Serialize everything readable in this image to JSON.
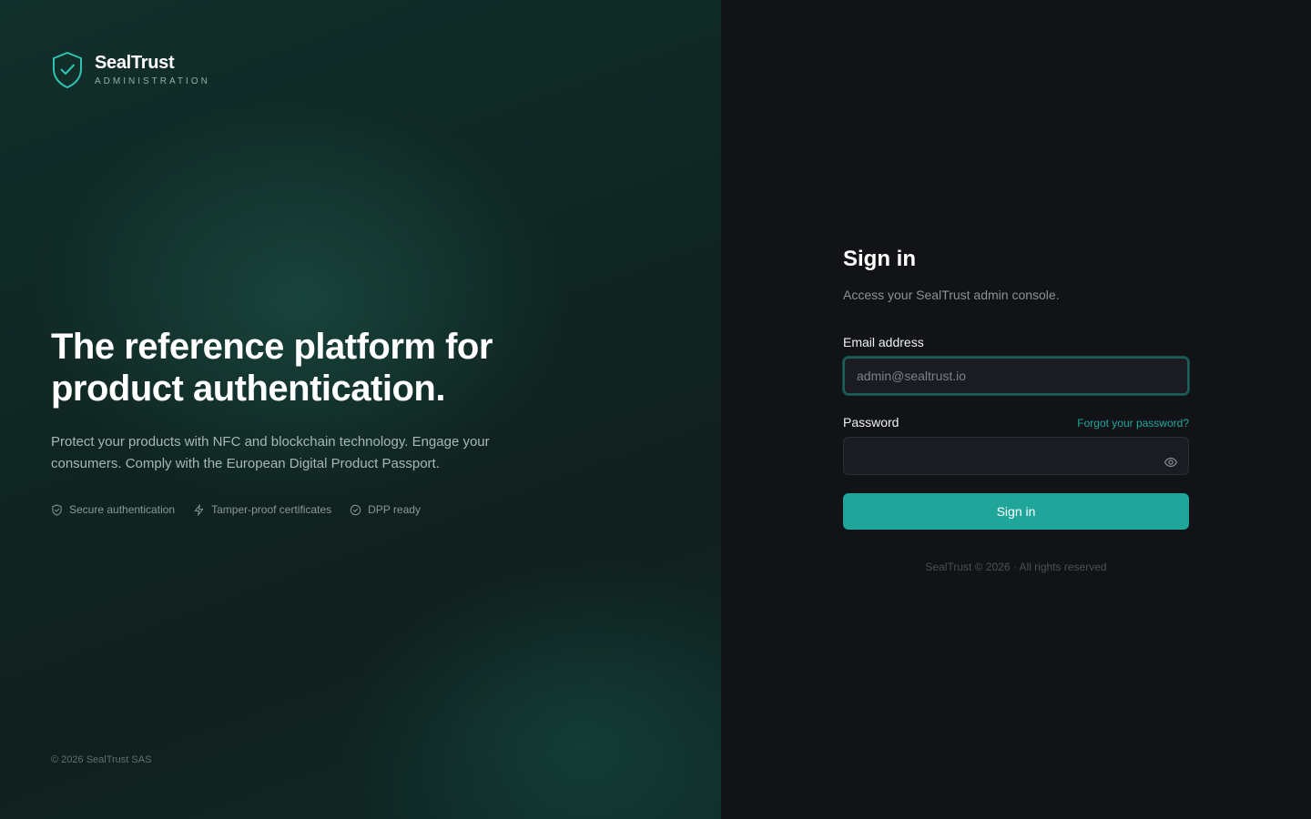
{
  "brand": {
    "name": "SealTrust",
    "subtitle": "ADMINISTRATION",
    "logo_icon": "shield-check-icon",
    "accent_color": "#1fa59a"
  },
  "hero": {
    "title": "The reference platform for product authentication.",
    "description": "Protect your products with NFC and blockchain technology. Engage your consumers. Comply with the European Digital Product Passport.",
    "features": [
      {
        "icon": "shield-icon",
        "label": "Secure authentication"
      },
      {
        "icon": "lightning-icon",
        "label": "Tamper-proof certificates"
      },
      {
        "icon": "check-circle-icon",
        "label": "DPP ready"
      }
    ],
    "footer": "© 2026 SealTrust SAS"
  },
  "form": {
    "title": "Sign in",
    "subtitle": "Access your SealTrust admin console.",
    "email_label": "Email address",
    "email_placeholder": "admin@sealtrust.io",
    "email_value": "",
    "password_label": "Password",
    "password_value": "",
    "forgot_label": "Forgot your password?",
    "submit_label": "Sign in",
    "footer": "SealTrust © 2026 · All rights reserved"
  }
}
